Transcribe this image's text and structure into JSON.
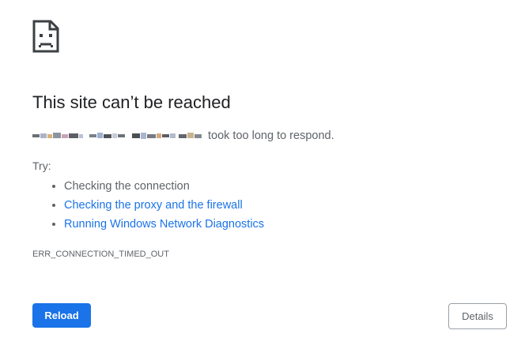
{
  "page": {
    "title": "This site can’t be reached",
    "summary_suffix": "took too long to respond.",
    "try_label": "Try:",
    "suggestions": [
      {
        "label": "Checking the connection",
        "is_link": false
      },
      {
        "label": "Checking the proxy and the firewall",
        "is_link": true
      },
      {
        "label": "Running Windows Network Diagnostics",
        "is_link": true
      }
    ],
    "error_code": "ERR_CONNECTION_TIMED_OUT"
  },
  "buttons": {
    "reload_label": "Reload",
    "details_label": "Details"
  },
  "icons": {
    "error_icon": "sad-page-icon"
  },
  "colors": {
    "accent": "#1a73e8",
    "text_primary": "#202124",
    "text_secondary": "#5f6368",
    "border": "#9aa0a6"
  }
}
